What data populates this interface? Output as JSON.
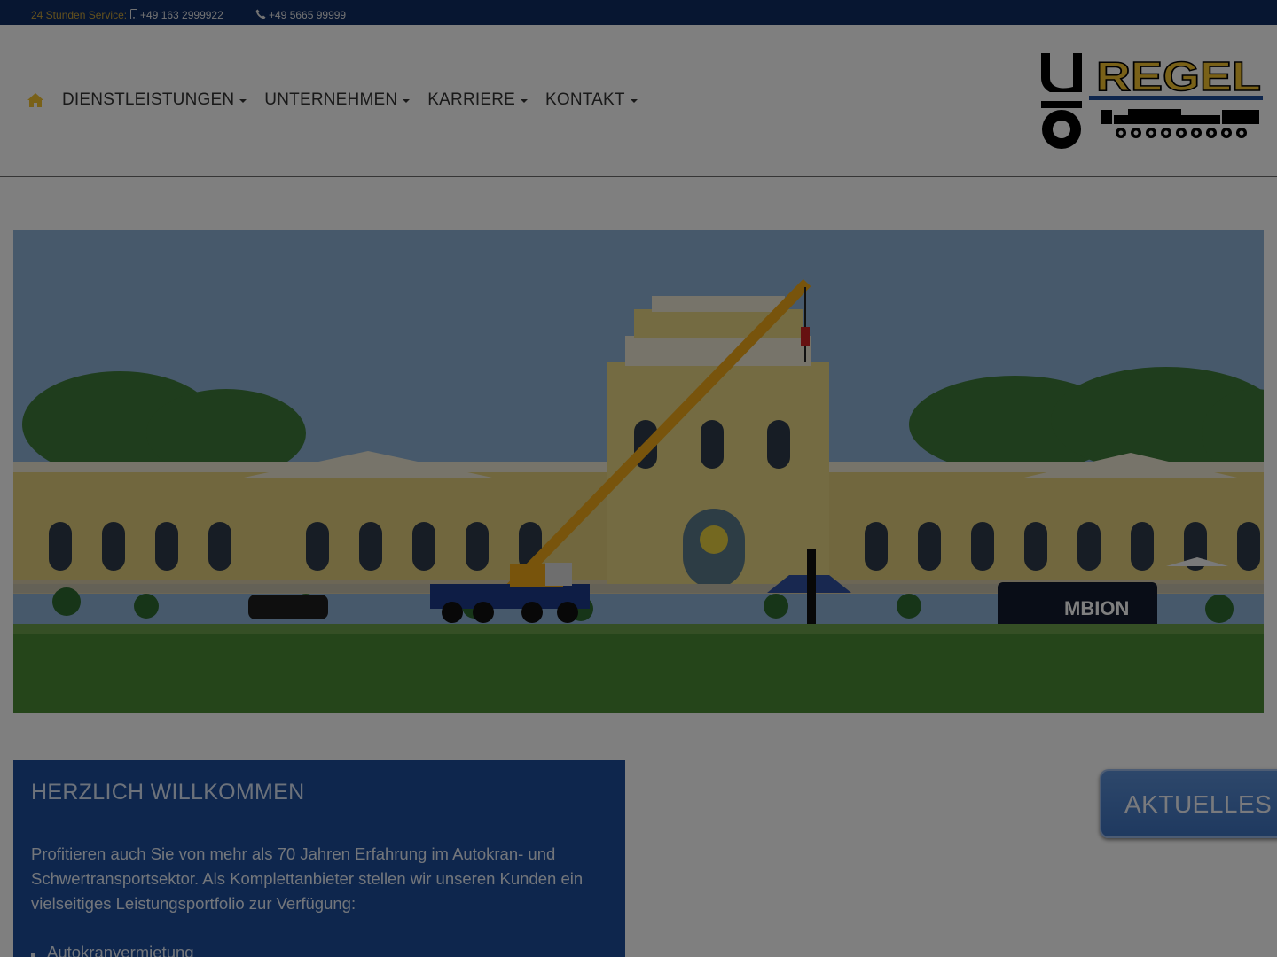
{
  "topbar": {
    "service_label": "24 Stunden Service:",
    "mobile": "+49 163 2999922",
    "phone": "+49 5665 99999"
  },
  "nav": {
    "items": [
      {
        "label": "DIENSTLEISTUNGEN"
      },
      {
        "label": "UNTERNEHMEN"
      },
      {
        "label": "KARRIERE"
      },
      {
        "label": "KONTAKT"
      }
    ]
  },
  "logo": {
    "text": "REGEL"
  },
  "welcome": {
    "title": "HERZLICH WILLKOMMEN",
    "text": "Profitieren auch Sie von mehr als 70 Jahren Erfahrung im Autokran- und Schwertransportsektor. Als Komplettanbieter stellen wir unseren Kunden ein vielseitiges Leistungsportfolio zur Verfügung:",
    "list": [
      "Autokranvermietung"
    ]
  },
  "aktuelles": {
    "label": "AKTUELLES"
  },
  "colors": {
    "topbar": "#0e2c62",
    "brand_yellow": "#f2c230",
    "welcome_bg": "#1d4d9b",
    "aktuelles_bg": "#4a80cc"
  }
}
